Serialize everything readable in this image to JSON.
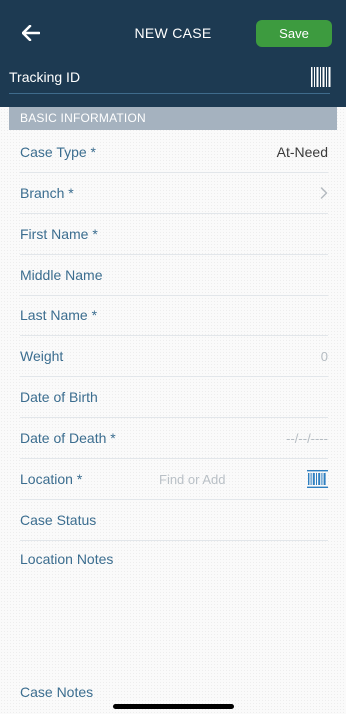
{
  "header": {
    "title": "NEW CASE",
    "save_label": "Save",
    "back_icon": "arrow-left-icon",
    "tracking_label": "Tracking ID",
    "tracking_icon": "barcode-icon",
    "background": "#1d3a52",
    "save_color": "#3d9b3f"
  },
  "section": {
    "title": "BASIC INFORMATION"
  },
  "fields": {
    "case_type": {
      "label": "Case Type *",
      "value": "At-Need"
    },
    "branch": {
      "label": "Branch *",
      "icon": "chevron-right-icon"
    },
    "first_name": {
      "label": "First Name *"
    },
    "middle_name": {
      "label": "Middle Name"
    },
    "last_name": {
      "label": "Last Name *"
    },
    "weight": {
      "label": "Weight",
      "placeholder": "0"
    },
    "date_of_birth": {
      "label": "Date of Birth"
    },
    "date_of_death": {
      "label": "Date of Death *",
      "placeholder": "--/--/----"
    },
    "location": {
      "label": "Location *",
      "placeholder": "Find or Add",
      "icon": "barcode-icon"
    },
    "case_status": {
      "label": "Case Status"
    },
    "location_notes": {
      "label": "Location Notes"
    },
    "case_notes": {
      "label": "Case Notes"
    }
  },
  "colors": {
    "label": "#3b6d8f",
    "section_header": "#a5b2bf",
    "barcode_accent": "#2e7fc0"
  }
}
